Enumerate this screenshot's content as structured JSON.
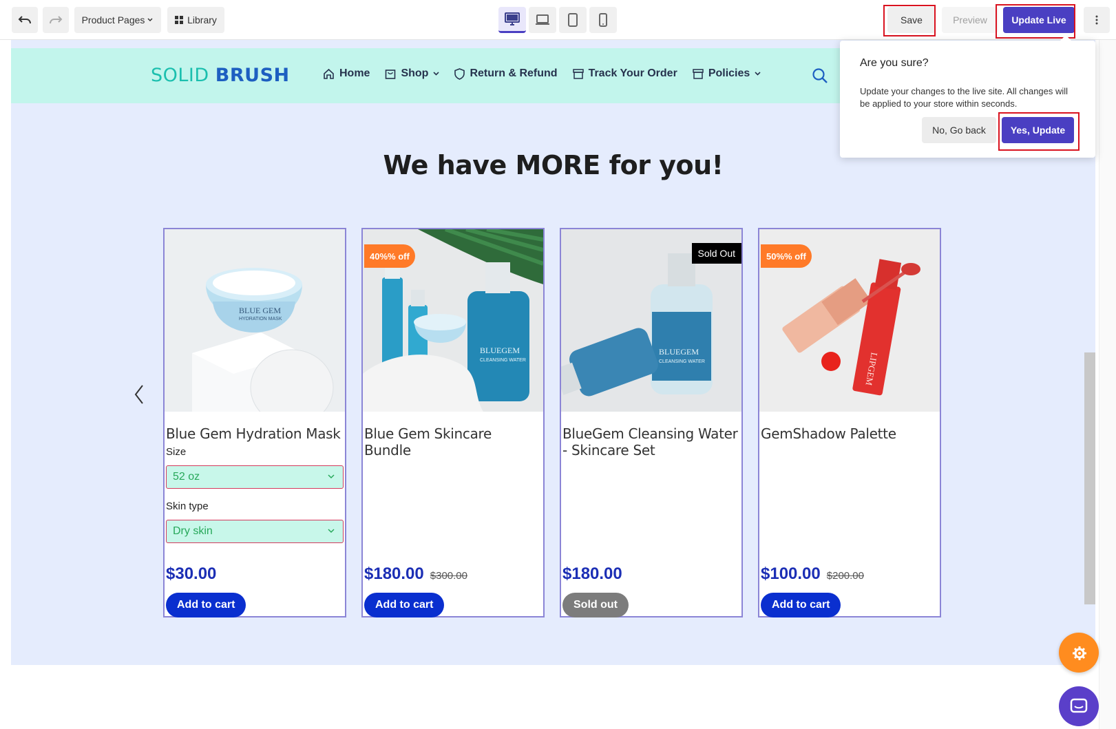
{
  "toolbar": {
    "product_pages_label": "Product Pages",
    "library_label": "Library",
    "save_label": "Save",
    "preview_label": "Preview",
    "update_live_label": "Update Live"
  },
  "site": {
    "logo_part1": "SOLID",
    "logo_part2": "BRUSH",
    "nav": [
      "Home",
      "Shop",
      "Return & Refund",
      "Track Your Order",
      "Policies"
    ],
    "headline": "We have MORE for you!"
  },
  "products": [
    {
      "name": "Blue Gem Hydration Mask",
      "badge": "",
      "size_label": "Size",
      "size_value": "52 oz",
      "skin_label": "Skin type",
      "skin_value": "Dry skin",
      "price": "$30.00",
      "old_price": "",
      "button": "Add to cart"
    },
    {
      "name": "Blue Gem Skincare Bundle",
      "badge": "40%% off",
      "price": "$180.00",
      "old_price": "$300.00",
      "button": "Add to cart"
    },
    {
      "name": "BlueGem Cleansing Water - Skincare Set",
      "badge": "Sold Out",
      "price": "$180.00",
      "old_price": "",
      "button": "Sold out"
    },
    {
      "name": "GemShadow Palette",
      "badge": "50%% off",
      "price": "$100.00",
      "old_price": "$200.00",
      "button": "Add to cart"
    }
  ],
  "product_images": {
    "p0_jar_text": "BLUE GEM",
    "p0_jar_sub": "HYDRATION MASK",
    "p1_bottle_text": "BLUEGEM",
    "p1_bottle_sub": "CLEANSING WATER",
    "p2_bottle_text": "BLUEGEM",
    "p2_bottle_sub": "CLEANSING WATER",
    "p3_tube_text": "LIPGEM"
  },
  "popover": {
    "title": "Are you sure?",
    "body": "Update your changes to the live site. All changes will be applied to your store within seconds.",
    "no_label": "No, Go back",
    "yes_label": "Yes, Update"
  },
  "colors": {
    "accent": "#4a3fc2",
    "header_bg": "#c2f5ec",
    "section_bg": "#e5ecfd",
    "price": "#1c2fb5",
    "cart_button": "#0a2fcf",
    "discount_badge": "#ff7a28",
    "highlight": "#d9121f"
  }
}
